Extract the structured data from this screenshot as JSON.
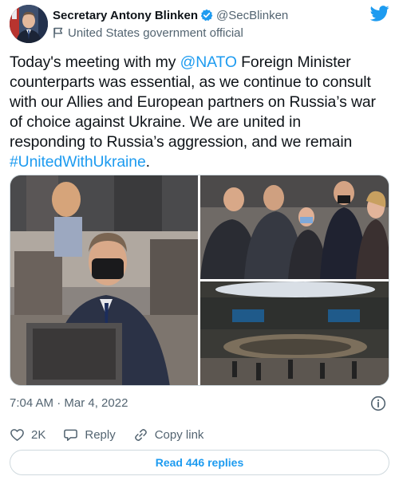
{
  "author": {
    "display_name": "Secretary Antony Blinken",
    "handle": "@SecBlinken",
    "account_label": "United States government official",
    "verified_icon": "verified-badge-icon",
    "label_icon": "flag-icon"
  },
  "brand": {
    "logo_icon": "twitter-bird-icon",
    "color": "#1d9bf0"
  },
  "tweet": {
    "line1_pre": "Today's meeting with my ",
    "mention": "@NATO",
    "line1_post": " Foreign Minister",
    "line2": "counterparts was essential, as we continue to consult",
    "line3": "with our Allies and European partners on Russia’s war",
    "line4": "of choice against Ukraine. We are united in",
    "line5": "responding to Russia’s aggression, and we remain",
    "hashtag": "#UnitedWithUkraine",
    "hashtag_suffix": "."
  },
  "media": {
    "photos": [
      {
        "name": "photo-blinken-at-desk"
      },
      {
        "name": "photo-ministers-conversation"
      },
      {
        "name": "photo-nato-conference-hall"
      }
    ]
  },
  "meta": {
    "timestamp": "7:04 AM · Mar 4, 2022",
    "info_icon": "info-icon"
  },
  "actions": {
    "like_count": "2K",
    "reply_label": "Reply",
    "copy_link_label": "Copy link"
  },
  "replies_button": {
    "label": "Read 446 replies"
  },
  "colors": {
    "link": "#1d9bf0",
    "secondary_text": "#536471",
    "border": "#cfd9de"
  }
}
